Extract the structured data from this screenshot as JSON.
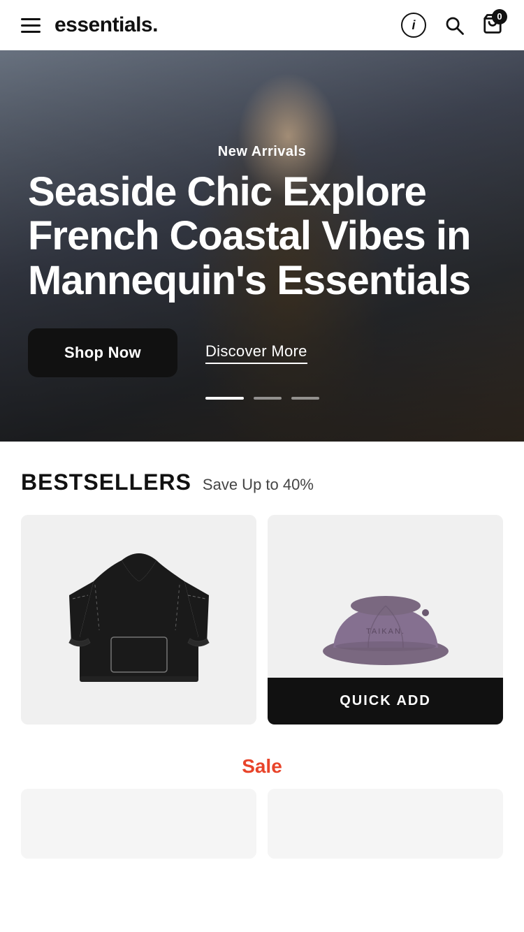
{
  "header": {
    "brand": "essentials.",
    "info_label": "i",
    "cart_count": "0"
  },
  "hero": {
    "subtitle": "New Arrivals",
    "title": "Seaside Chic Explore French Coastal Vibes in Mannequin's Essentials",
    "shop_now_label": "Shop Now",
    "discover_more_label": "Discover More",
    "dots": [
      {
        "active": true
      },
      {
        "active": false
      },
      {
        "active": false
      }
    ]
  },
  "bestsellers": {
    "title": "BESTSELLERS",
    "subtitle": "Save Up to 40%",
    "products": [
      {
        "id": "hoodie-1",
        "type": "hoodie",
        "name": "Black Hoodie"
      },
      {
        "id": "hat-1",
        "type": "hat",
        "name": "Taikan Bucket Hat",
        "quick_add_label": "QUICK ADD"
      }
    ]
  },
  "sale": {
    "label": "Sale"
  }
}
